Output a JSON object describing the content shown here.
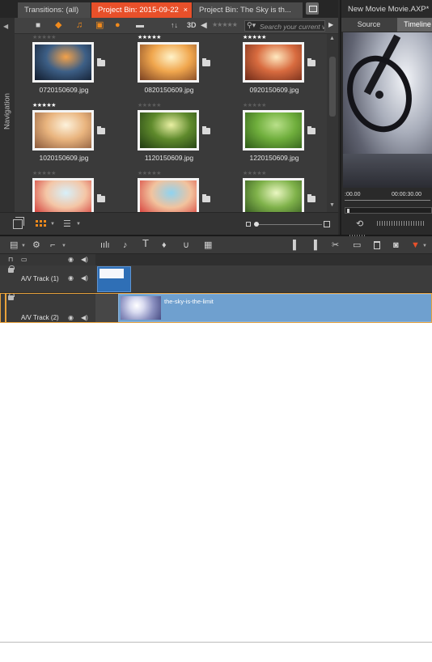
{
  "library": {
    "tabs": [
      {
        "label": "Transitions: (all)"
      },
      {
        "label": "Project Bin: 2015-09-22",
        "close": "×"
      },
      {
        "label": "Project Bin: The Sky is th..."
      }
    ],
    "navigation_label": "Navigation",
    "filter_bar": {
      "sort_label": "↑↓",
      "three_d_label": "3D",
      "rating_stars": "★★★★★",
      "search_placeholder": "Search your current v",
      "search_icon": "search-icon"
    },
    "items": [
      {
        "filename": "0720150609.jpg",
        "rating": "★★★★★",
        "rated": false,
        "colors": [
          "#f4a24a",
          "#3d5f86",
          "#101a2b"
        ]
      },
      {
        "filename": "0820150609.jpg",
        "rating": "★★★★★",
        "rated": true,
        "colors": [
          "#fff3c9",
          "#f0a64d",
          "#7a4021"
        ]
      },
      {
        "filename": "0920150609.jpg",
        "rating": "★★★★★",
        "rated": true,
        "colors": [
          "#ffe9c0",
          "#d86b3f",
          "#6e2a18"
        ]
      },
      {
        "filename": "1020150609.jpg",
        "rating": "★★★★★",
        "rated": true,
        "colors": [
          "#fdf2dc",
          "#e9b47e",
          "#8b5a3c"
        ]
      },
      {
        "filename": "1120150609.jpg",
        "rating": "★★★★★",
        "rated": false,
        "colors": [
          "#e9f0a3",
          "#5f8a2c",
          "#1f3a12"
        ]
      },
      {
        "filename": "1220150609.jpg",
        "rating": "★★★★★",
        "rated": false,
        "colors": [
          "#b9e08a",
          "#6fae3c",
          "#2e5a18"
        ]
      },
      {
        "filename": "",
        "rating": "★★★★★",
        "rated": false,
        "colors": [
          "#d7f0fa",
          "#f4c6a6",
          "#cf2b2b"
        ]
      },
      {
        "filename": "",
        "rating": "★★★★★",
        "rated": false,
        "colors": [
          "#8fd3f0",
          "#f2c39e",
          "#d43030"
        ]
      },
      {
        "filename": "",
        "rating": "★★★★★",
        "rated": false,
        "colors": [
          "#eaf7c2",
          "#7fb24a",
          "#2d4f1c"
        ]
      }
    ]
  },
  "player": {
    "title": "New Movie Movie.AXP*",
    "tabs": {
      "source": "Source",
      "timeline": "Timeline"
    },
    "timecode_start": ":00.00",
    "timecode_mid": "00:00:30.00"
  },
  "timeline": {
    "tracks": [
      {
        "name": "A/V Track (1)"
      },
      {
        "name": "A/V Track (2)",
        "clip_title": "the-sky-is-the-limit"
      }
    ]
  },
  "colors": {
    "accent": "#e8502a",
    "orange_icons": "#f08a1c",
    "clip_blue": "#6fa0cf"
  }
}
